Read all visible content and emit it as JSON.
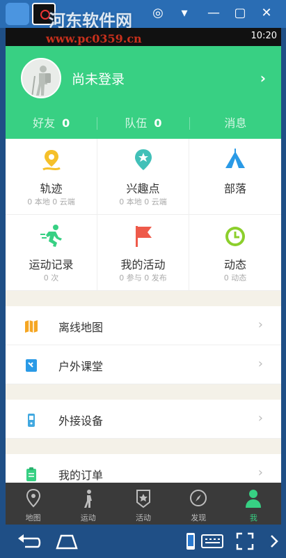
{
  "watermark": {
    "text": "河东软件网",
    "url": "www.pc0359.cn"
  },
  "status_bar": {
    "time": "10:20"
  },
  "profile": {
    "name": "尚未登录"
  },
  "stats": [
    {
      "label": "好友",
      "value": "0"
    },
    {
      "label": "队伍",
      "value": "0"
    },
    {
      "label": "消息",
      "value": ""
    }
  ],
  "grid": [
    {
      "title": "轨迹",
      "sub": "0 本地   0 云端",
      "icon": "location-pin-icon",
      "color": "#f5c02a"
    },
    {
      "title": "兴趣点",
      "sub": "0 本地   0 云端",
      "icon": "star-pin-icon",
      "color": "#41c0b8"
    },
    {
      "title": "部落",
      "sub": "",
      "icon": "tent-icon",
      "color": "#2a9ae6"
    },
    {
      "title": "运动记录",
      "sub": "0 次",
      "icon": "running-icon",
      "color": "#37d083"
    },
    {
      "title": "我的活动",
      "sub": "0 参与   0 发布",
      "icon": "flag-icon",
      "color": "#ee5a4a"
    },
    {
      "title": "动态",
      "sub": "0 动态",
      "icon": "clock-icon",
      "color": "#8ccf2c"
    }
  ],
  "list": [
    {
      "label": "离线地图",
      "icon": "map-icon",
      "color": "#f5a623"
    },
    {
      "label": "户外课堂",
      "icon": "book-icon",
      "color": "#2a9ae6"
    },
    {
      "label": "外接设备",
      "icon": "device-icon",
      "color": "#41a8e0"
    },
    {
      "label": "我的订单",
      "icon": "order-icon",
      "color": "#37d083"
    }
  ],
  "tabs": [
    {
      "label": "地图",
      "icon": "map-pin-icon",
      "active": false
    },
    {
      "label": "运动",
      "icon": "walker-icon",
      "active": false
    },
    {
      "label": "活动",
      "icon": "badge-icon",
      "active": false
    },
    {
      "label": "发现",
      "icon": "compass-icon",
      "active": false
    },
    {
      "label": "我",
      "icon": "person-icon",
      "active": true
    }
  ],
  "colors": {
    "accent": "#37d083",
    "header": "#38d083",
    "tabbar": "#3a3a3a"
  }
}
